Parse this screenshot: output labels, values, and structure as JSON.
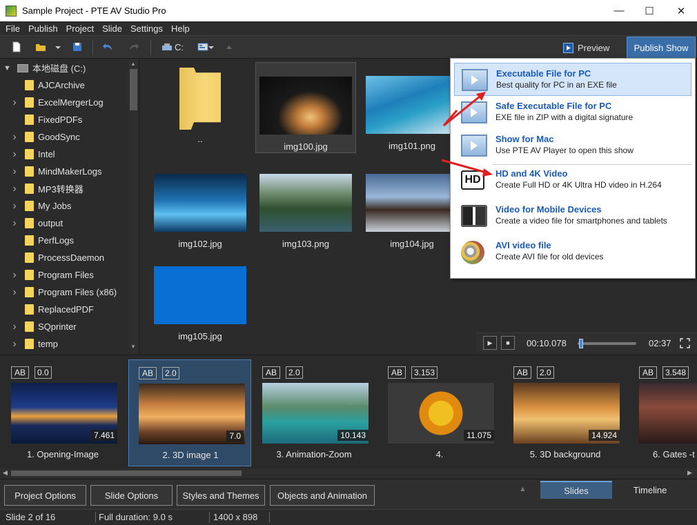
{
  "window": {
    "title": "Sample Project - PTE AV Studio Pro",
    "minimize": "—",
    "maximize": "☐",
    "close": "✕"
  },
  "menu": [
    "File",
    "Publish",
    "Project",
    "Slide",
    "Settings",
    "Help"
  ],
  "toolbar": {
    "drive_label": "C:",
    "preview_label": "Preview",
    "publish_label": "Publish Show"
  },
  "tree": {
    "root": "本地磁盘 (C:)",
    "items": [
      {
        "label": "AJCArchive",
        "expandable": false
      },
      {
        "label": "ExcelMergerLog",
        "expandable": true
      },
      {
        "label": "FixedPDFs",
        "expandable": false
      },
      {
        "label": "GoodSync",
        "expandable": true
      },
      {
        "label": "Intel",
        "expandable": true
      },
      {
        "label": "MindMakerLogs",
        "expandable": true
      },
      {
        "label": "MP3转换器",
        "expandable": true
      },
      {
        "label": "My Jobs",
        "expandable": true
      },
      {
        "label": "output",
        "expandable": true
      },
      {
        "label": "PerfLogs",
        "expandable": false
      },
      {
        "label": "ProcessDaemon",
        "expandable": false
      },
      {
        "label": "Program Files",
        "expandable": true
      },
      {
        "label": "Program Files (x86)",
        "expandable": true
      },
      {
        "label": "ReplacedPDF",
        "expandable": false
      },
      {
        "label": "SQprinter",
        "expandable": true
      },
      {
        "label": "temp",
        "expandable": true
      }
    ]
  },
  "files": [
    {
      "name": "..",
      "kind": "folder"
    },
    {
      "name": "img100.jpg",
      "kind": "image",
      "selected": true
    },
    {
      "name": "img101.png",
      "kind": "image"
    },
    {
      "name": "img102.jpg",
      "kind": "image"
    },
    {
      "name": "img103.png",
      "kind": "image"
    },
    {
      "name": "img104.jpg",
      "kind": "image"
    },
    {
      "name": "img105.jpg",
      "kind": "image"
    }
  ],
  "publish_menu": [
    {
      "title": "Executable File for PC",
      "desc": "Best quality for PC in an EXE file",
      "icon": "exe-screen-icon",
      "highlight": true
    },
    {
      "title": "Safe Executable File for PC",
      "desc": "EXE file in ZIP with a digital signature",
      "icon": "zip-screen-icon"
    },
    {
      "title": "Show for Mac",
      "desc": "Use PTE AV Player to open this show",
      "icon": "mac-screen-icon"
    },
    {
      "title": "HD and 4K Video",
      "desc": "Create Full HD or 4K Ultra HD video in H.264",
      "icon": "hd-icon"
    },
    {
      "title": "Video for Mobile Devices",
      "desc": "Create a video file for smartphones and tablets",
      "icon": "mobile-devices-icon"
    },
    {
      "title": "AVI video file",
      "desc": "Create AVI file for old devices",
      "icon": "film-reel-icon"
    }
  ],
  "hd_badge": "HD",
  "player": {
    "current_time": "00:10.078",
    "total_time": "02:37",
    "position": 0.06
  },
  "slides": [
    {
      "ab": "AB",
      "duration": "0.0",
      "time": "7.461",
      "caption": "1. Opening-Image"
    },
    {
      "ab": "AB",
      "duration": "2.0",
      "time": "7.0",
      "caption": "2. 3D image 1",
      "selected": true
    },
    {
      "ab": "AB",
      "duration": "2.0",
      "time": "10.143",
      "caption": "3. Animation-Zoom"
    },
    {
      "ab": "AB",
      "duration": "3.153",
      "time": "11.075",
      "caption": "4."
    },
    {
      "ab": "AB",
      "duration": "2.0",
      "time": "14.924",
      "caption": "5. 3D background"
    },
    {
      "ab": "AB",
      "duration": "3.548",
      "time": "",
      "caption": "6. Gates -t"
    }
  ],
  "bottom_buttons": [
    "Project Options",
    "Slide Options",
    "Styles and Themes",
    "Objects and Animation"
  ],
  "bottom_tabs": {
    "slides": "Slides",
    "timeline": "Timeline"
  },
  "status": {
    "slide": "Slide 2 of 16",
    "duration": "Full duration: 9.0 s",
    "resolution": "1400 x 898"
  },
  "colors": {
    "accent": "#3a6ea8",
    "menu_title": "#1a5bb8",
    "highlight": "#d5e6fa",
    "arrow": "#e02020"
  }
}
